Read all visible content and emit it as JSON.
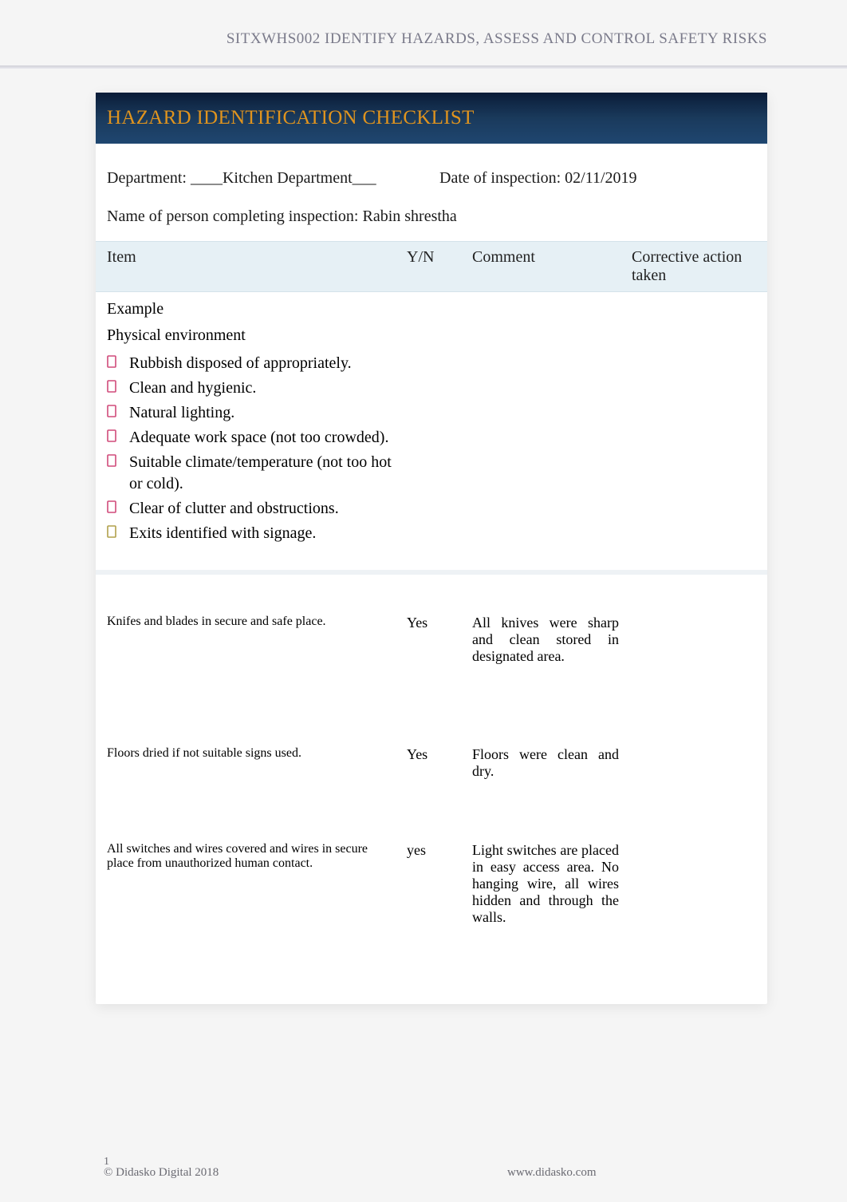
{
  "header": {
    "course_code": "SITXWHS002 IDENTIFY HAZARDS, ASSESS AND CONTROL SAFETY RISKS"
  },
  "title": "HAZARD IDENTIFICATION CHECKLIST",
  "meta": {
    "dept_label": "Department: ____Kitchen Department___",
    "date_label": "Date of inspection: 02/11/2019",
    "name_label": "Name of person completing inspection: Rabin shrestha"
  },
  "columns": {
    "item": "Item",
    "yn": "Y/N",
    "comment": "Comment",
    "action": "Corrective action taken"
  },
  "example_label": "Example",
  "phys_label": "Physical environment",
  "bullets": [
    {
      "text": "Rubbish disposed of appropriately.",
      "color": "#d04a7a"
    },
    {
      "text": "Clean and hygienic.",
      "color": "#d04a7a"
    },
    {
      "text": "Natural lighting.",
      "color": "#d04a7a"
    },
    {
      "text": "Adequate work space (not too crowded).",
      "color": "#d04a7a"
    },
    {
      "text": "Suitable climate/temperature (not too hot or cold).",
      "color": "#d04a7a"
    },
    {
      "text": "Clear of clutter and obstructions.",
      "color": "#d04a7a"
    },
    {
      "text": "Exits identified with signage.",
      "color": "#b0a04a"
    }
  ],
  "rows": [
    {
      "item": "Knifes and blades in secure and safe place.",
      "yn": "Yes",
      "comment": "All knives were sharp and clean stored in designated area.",
      "action": ""
    },
    {
      "item": "Floors dried if not suitable signs used.",
      "yn": "Yes",
      "comment": "Floors were clean and dry.",
      "action": ""
    },
    {
      "item": "All switches and wires covered and wires in secure place from unauthorized human contact.",
      "yn": "yes",
      "comment": "Light switches are placed in easy access area. No hanging wire, all wires hidden and through the walls.",
      "action": ""
    }
  ],
  "footer": {
    "page": "1",
    "copyright": "© Didasko Digital 2018",
    "url": "www.didasko.com"
  }
}
